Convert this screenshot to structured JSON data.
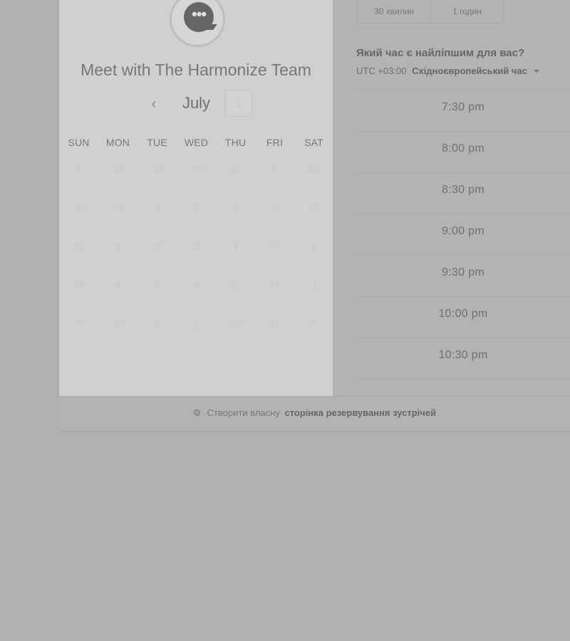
{
  "booking": {
    "title": "Meet with The Harmonize Team",
    "month": "July",
    "prev_label": "‹",
    "next_label": "›",
    "weekdays": [
      "SUN",
      "MON",
      "TUE",
      "WED",
      "THU",
      "FRI",
      "SAT"
    ],
    "days": [
      [
        "7",
        "26",
        "25",
        "24",
        "22",
        "9",
        "15"
      ],
      [
        "4",
        "15",
        "3",
        "7",
        "2",
        "20",
        "17"
      ],
      [
        "28",
        "8",
        "27",
        "11",
        "4",
        "16",
        "5"
      ],
      [
        "24",
        "4",
        "3",
        "8",
        "27",
        "18",
        "1"
      ],
      [
        "8",
        "30",
        "3",
        "9",
        "10",
        "31",
        "4"
      ]
    ]
  },
  "durations": [
    "30 хвилин",
    "1 годин"
  ],
  "availability": {
    "question": "Який час є найліпшим для вас?",
    "timezone_offset": "UTC +03:00",
    "timezone_name": "Східноєвропейський час",
    "slots": [
      "7:30 pm",
      "8:00 pm",
      "8:30 pm",
      "9:00 pm",
      "9:30 pm",
      "10:00 pm",
      "10:30 pm"
    ]
  },
  "footer": {
    "icon": "hubspot-sprocket-icon",
    "text": "Створити власну",
    "strong": "сторінка резервування зустрічей"
  },
  "colors": {
    "background": "#b1b1b1",
    "panel": "#d0d0d0"
  }
}
